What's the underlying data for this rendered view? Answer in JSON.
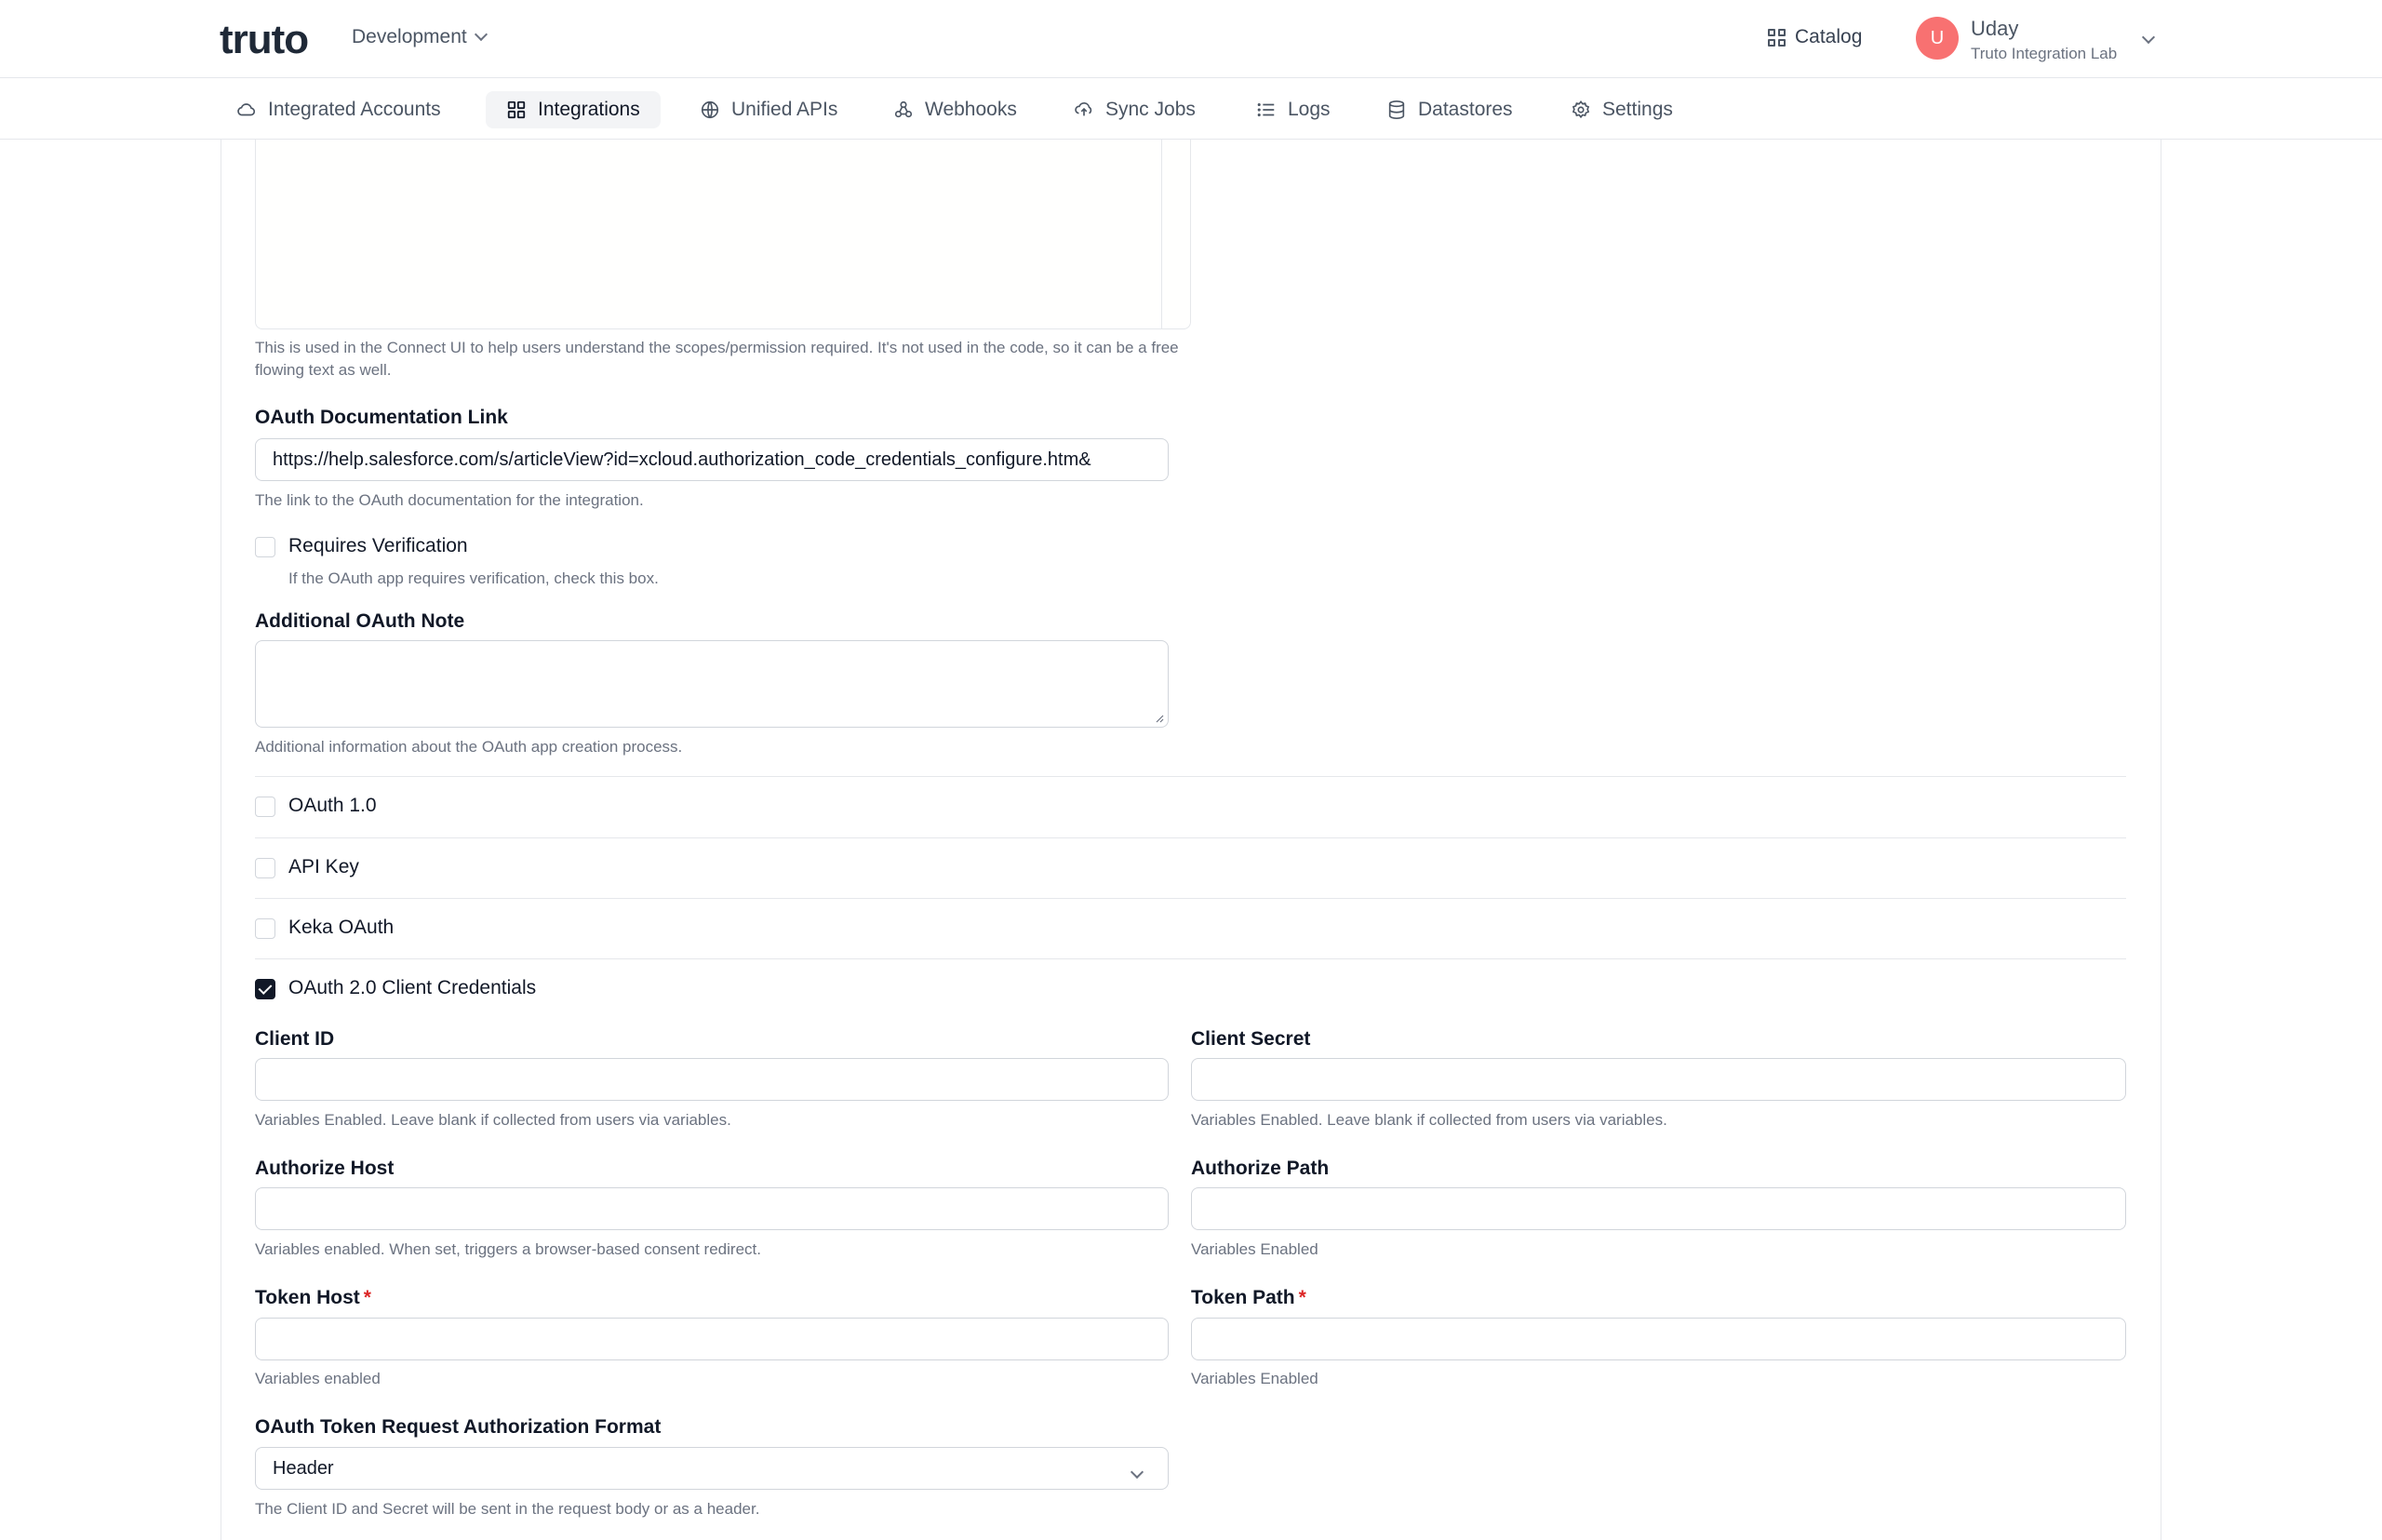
{
  "header": {
    "logo_text": "truto",
    "environment": "Development",
    "catalog_label": "Catalog",
    "user": {
      "initial": "U",
      "name": "Uday",
      "org": "Truto Integration Lab"
    }
  },
  "nav": {
    "items": [
      {
        "label": "Integrated Accounts",
        "icon": "cloud-icon"
      },
      {
        "label": "Integrations",
        "icon": "grid-icon",
        "active": true
      },
      {
        "label": "Unified APIs",
        "icon": "globe-icon"
      },
      {
        "label": "Webhooks",
        "icon": "webhook-icon"
      },
      {
        "label": "Sync Jobs",
        "icon": "cloud-sync-icon"
      },
      {
        "label": "Logs",
        "icon": "list-icon"
      },
      {
        "label": "Datastores",
        "icon": "database-icon"
      },
      {
        "label": "Settings",
        "icon": "gear-icon"
      }
    ]
  },
  "form": {
    "scope_help": "This is used in the Connect UI to help users understand the scopes/permission required. It's not used in the code, so it can be a free flowing text as well.",
    "oauth_doc_link": {
      "label": "OAuth Documentation Link",
      "value": "https://help.salesforce.com/s/articleView?id=xcloud.authorization_code_credentials_configure.htm&",
      "help": "The link to the OAuth documentation for the integration."
    },
    "requires_verification": {
      "label": "Requires Verification",
      "help": "If the OAuth app requires verification, check this box.",
      "checked": false
    },
    "additional_note": {
      "label": "Additional OAuth Note",
      "value": "",
      "help": "Additional information about the OAuth app creation process."
    },
    "auth_methods": [
      {
        "label": "OAuth 1.0",
        "checked": false
      },
      {
        "label": "API Key",
        "checked": false
      },
      {
        "label": "Keka OAuth",
        "checked": false
      },
      {
        "label": "OAuth 2.0 Client Credentials",
        "checked": true
      }
    ],
    "client_id": {
      "label": "Client ID",
      "value": "",
      "help": "Variables Enabled. Leave blank if collected from users via variables."
    },
    "client_secret": {
      "label": "Client Secret",
      "value": "",
      "help": "Variables Enabled. Leave blank if collected from users via variables."
    },
    "authorize_host": {
      "label": "Authorize Host",
      "value": "",
      "help": "Variables enabled. When set, triggers a browser-based consent redirect."
    },
    "authorize_path": {
      "label": "Authorize Path",
      "value": "",
      "help": "Variables Enabled"
    },
    "token_host": {
      "label": "Token Host",
      "required_mark": "*",
      "value": "",
      "help": "Variables enabled"
    },
    "token_path": {
      "label": "Token Path",
      "required_mark": "*",
      "value": "",
      "help": "Variables Enabled"
    },
    "token_auth_format": {
      "label": "OAuth Token Request Authorization Format",
      "value": "Header",
      "help": "The Client ID and Secret will be sent in the request body or as a header."
    }
  }
}
